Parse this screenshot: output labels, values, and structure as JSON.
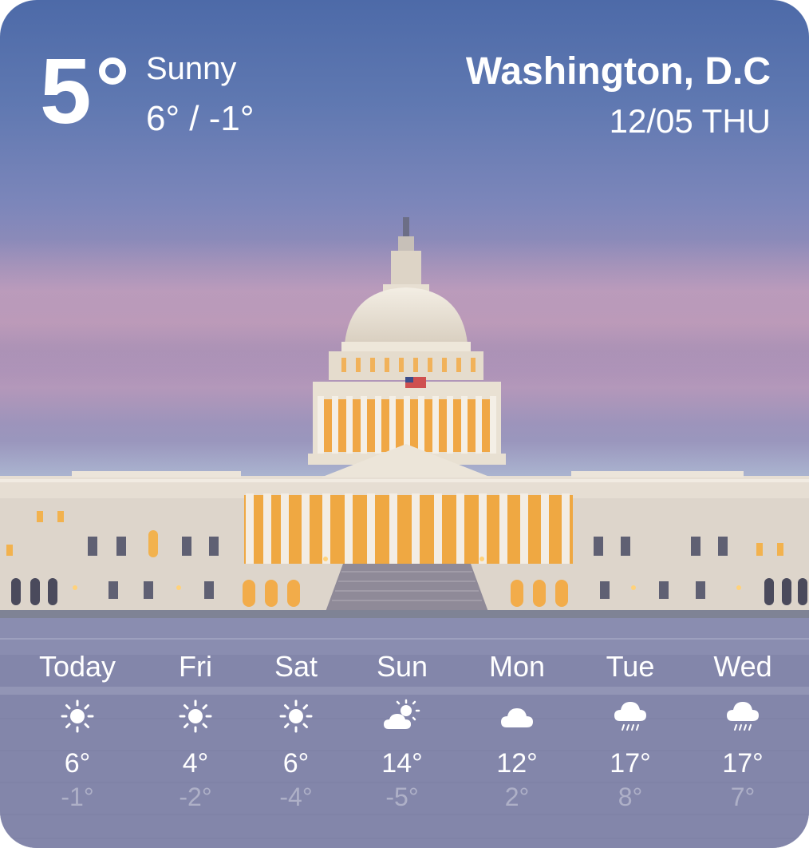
{
  "current": {
    "temperature": "5",
    "condition": "Sunny",
    "range": "6° / -1°"
  },
  "location": {
    "city": "Washington, D.C",
    "date": "12/05 THU"
  },
  "forecast": [
    {
      "day": "Today",
      "icon": "sun-icon",
      "high": "6°",
      "low": "-1°"
    },
    {
      "day": "Fri",
      "icon": "sun-icon",
      "high": "4°",
      "low": "-2°"
    },
    {
      "day": "Sat",
      "icon": "sun-icon",
      "high": "6°",
      "low": "-4°"
    },
    {
      "day": "Sun",
      "icon": "partly-cloudy-icon",
      "high": "14°",
      "low": "-5°"
    },
    {
      "day": "Mon",
      "icon": "cloud-icon",
      "high": "12°",
      "low": "2°"
    },
    {
      "day": "Tue",
      "icon": "rain-icon",
      "high": "17°",
      "low": "8°"
    },
    {
      "day": "Wed",
      "icon": "rain-icon",
      "high": "17°",
      "low": "7°"
    }
  ],
  "colors": {
    "sky_top": "#4d6aa8",
    "sky_pink": "#b697b7",
    "building": "#e8e2dc",
    "warm_light": "#f2a640",
    "text": "#ffffff"
  }
}
